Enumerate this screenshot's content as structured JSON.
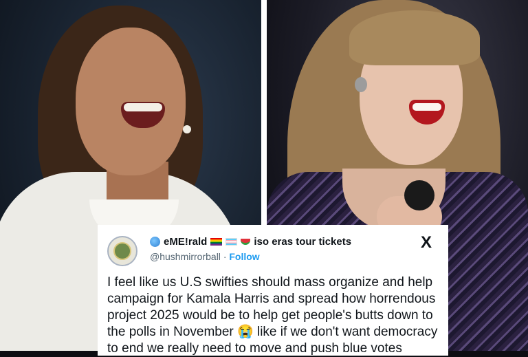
{
  "tweet": {
    "display_name": "eME!rald",
    "bio_suffix": "iso eras tour tickets",
    "handle": "@hushmirrorball",
    "separator": "·",
    "follow_label": "Follow",
    "x_logo": "X",
    "body": "I feel like us U.S swifties should mass organize and help\ncampaign for Kamala Harris and spread how horrendous\nproject 2025 would be to help get people's butts down to\nthe polls in November 😭 like if we don't want democracy\nto end we really need to move and push blue votes",
    "icons": [
      "globe-icon",
      "rainbow-flag-icon",
      "trans-flag-icon",
      "watermelon-icon",
      "x-logo-icon"
    ]
  },
  "colors": {
    "link": "#1d9bf0",
    "text": "#0f1419",
    "secondary_text": "#536471"
  }
}
